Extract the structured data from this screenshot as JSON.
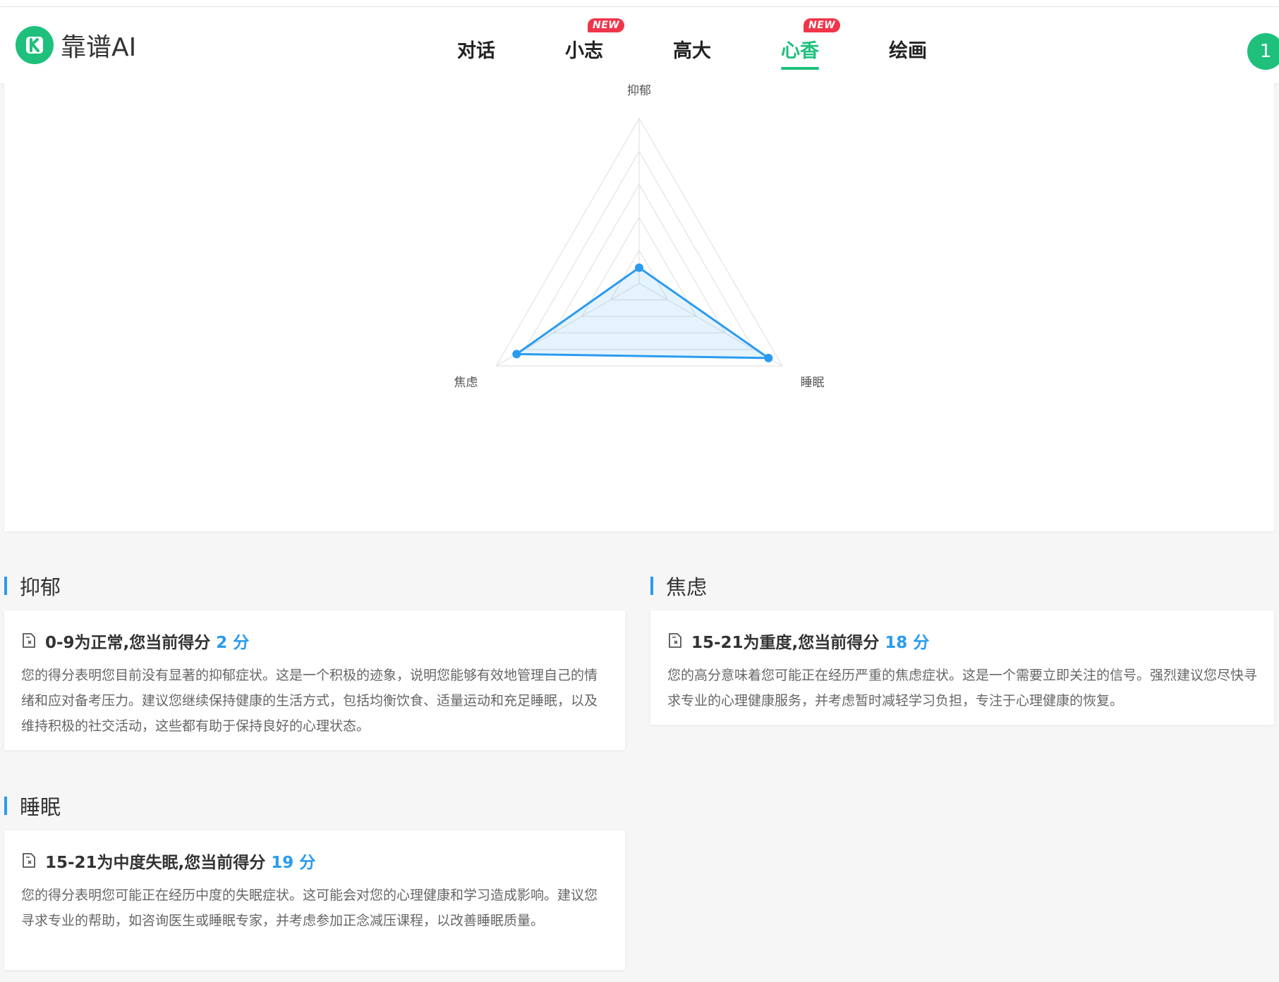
{
  "header": {
    "logo_text": "靠谱AI",
    "nav": [
      {
        "label": "对话",
        "badge": ""
      },
      {
        "label": "小志",
        "badge": "NEW"
      },
      {
        "label": "高大",
        "badge": ""
      },
      {
        "label": "心香",
        "badge": "NEW",
        "active": true
      },
      {
        "label": "绘画",
        "badge": ""
      }
    ],
    "avatar_text": "1"
  },
  "chart_data": {
    "type": "radar",
    "axes": [
      "抑郁",
      "睡眠",
      "焦虑"
    ],
    "max": 21,
    "rings": 5,
    "series": [
      {
        "values": [
          2,
          19,
          18
        ]
      }
    ],
    "colors": {
      "line": "#2a9bf0",
      "fill": "rgba(42,155,240,0.12)",
      "grid": "#e3e3e3"
    }
  },
  "sections": [
    {
      "title": "抑郁",
      "headline": "0-9为正常,您当前得分",
      "score": "2 分",
      "body": "您的得分表明您目前没有显著的抑郁症状。这是一个积极的迹象，说明您能够有效地管理自己的情绪和应对备考压力。建议您继续保持健康的生活方式，包括均衡饮食、适量运动和充足睡眠，以及维持积极的社交活动，这些都有助于保持良好的心理状态。"
    },
    {
      "title": "焦虑",
      "headline": "15-21为重度,您当前得分",
      "score": "18 分",
      "body": "您的高分意味着您可能正在经历严重的焦虑症状。这是一个需要立即关注的信号。强烈建议您尽快寻求专业的心理健康服务，并考虑暂时减轻学习负担，专注于心理健康的恢复。"
    },
    {
      "title": "睡眠",
      "headline": "15-21为中度失眠,您当前得分",
      "score": "19 分",
      "body": "您的得分表明您可能正在经历中度的失眠症状。这可能会对您的心理健康和学习造成影响。建议您寻求专业的帮助，如咨询医生或睡眠专家，并考虑参加正念减压课程，以改善睡眠质量。"
    }
  ]
}
